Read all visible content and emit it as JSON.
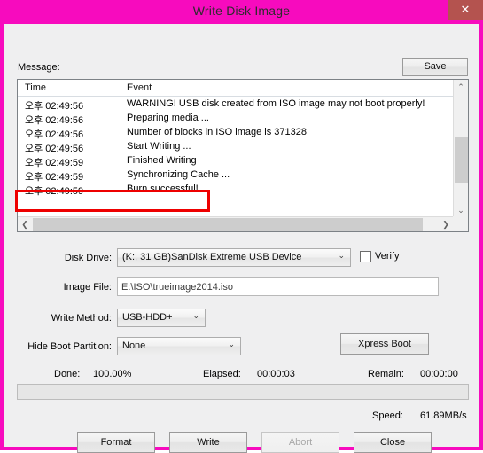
{
  "window": {
    "title": "Write Disk Image",
    "close_icon": "✕",
    "accent_color": "#f70bbe",
    "close_button_color": "#b4534f"
  },
  "message": {
    "label": "Message:",
    "save_label": "Save"
  },
  "log": {
    "columns": [
      "Time",
      "Event"
    ],
    "rows": [
      {
        "time": "오후 02:49:56",
        "event": "WARNING! USB disk created from ISO image may not boot properly!"
      },
      {
        "time": "오후 02:49:56",
        "event": "Preparing media ..."
      },
      {
        "time": "오후 02:49:56",
        "event": "Number of blocks in ISO image is 371328"
      },
      {
        "time": "오후 02:49:56",
        "event": "Start Writing ..."
      },
      {
        "time": "오후 02:49:59",
        "event": "Finished Writing"
      },
      {
        "time": "오후 02:49:59",
        "event": "Synchronizing Cache ..."
      },
      {
        "time": "오후 02:49:59",
        "event": "Burn successful!"
      }
    ],
    "scroll_up_icon": "⌃",
    "scroll_down_icon": "⌄",
    "scroll_left_icon": "❮",
    "scroll_right_icon": "❯",
    "highlight_color": "#ee0000",
    "highlighted_row_index": 6
  },
  "form": {
    "disk_drive_label": "Disk Drive:",
    "disk_drive_value": "(K:, 31 GB)SanDisk Extreme USB Device",
    "verify_label": "Verify",
    "verify_checked": false,
    "image_file_label": "Image File:",
    "image_file_value": "E:\\ISO\\trueimage2014.iso",
    "image_file_placeholder": "",
    "write_method_label": "Write Method:",
    "write_method_value": "USB-HDD+",
    "hide_boot_label": "Hide Boot Partition:",
    "hide_boot_value": "None",
    "xpress_boot_label": "Xpress Boot",
    "dropdown_icon": "⌄"
  },
  "status": {
    "done_label": "Done:",
    "done_value": "100.00%",
    "elapsed_label": "Elapsed:",
    "elapsed_value": "00:00:03",
    "remain_label": "Remain:",
    "remain_value": "00:00:00",
    "speed_label": "Speed:",
    "speed_value": "61.89MB/s",
    "progress_percent": 0
  },
  "buttons": {
    "format": "Format",
    "write": "Write",
    "abort": "Abort",
    "close": "Close",
    "abort_disabled": true
  }
}
